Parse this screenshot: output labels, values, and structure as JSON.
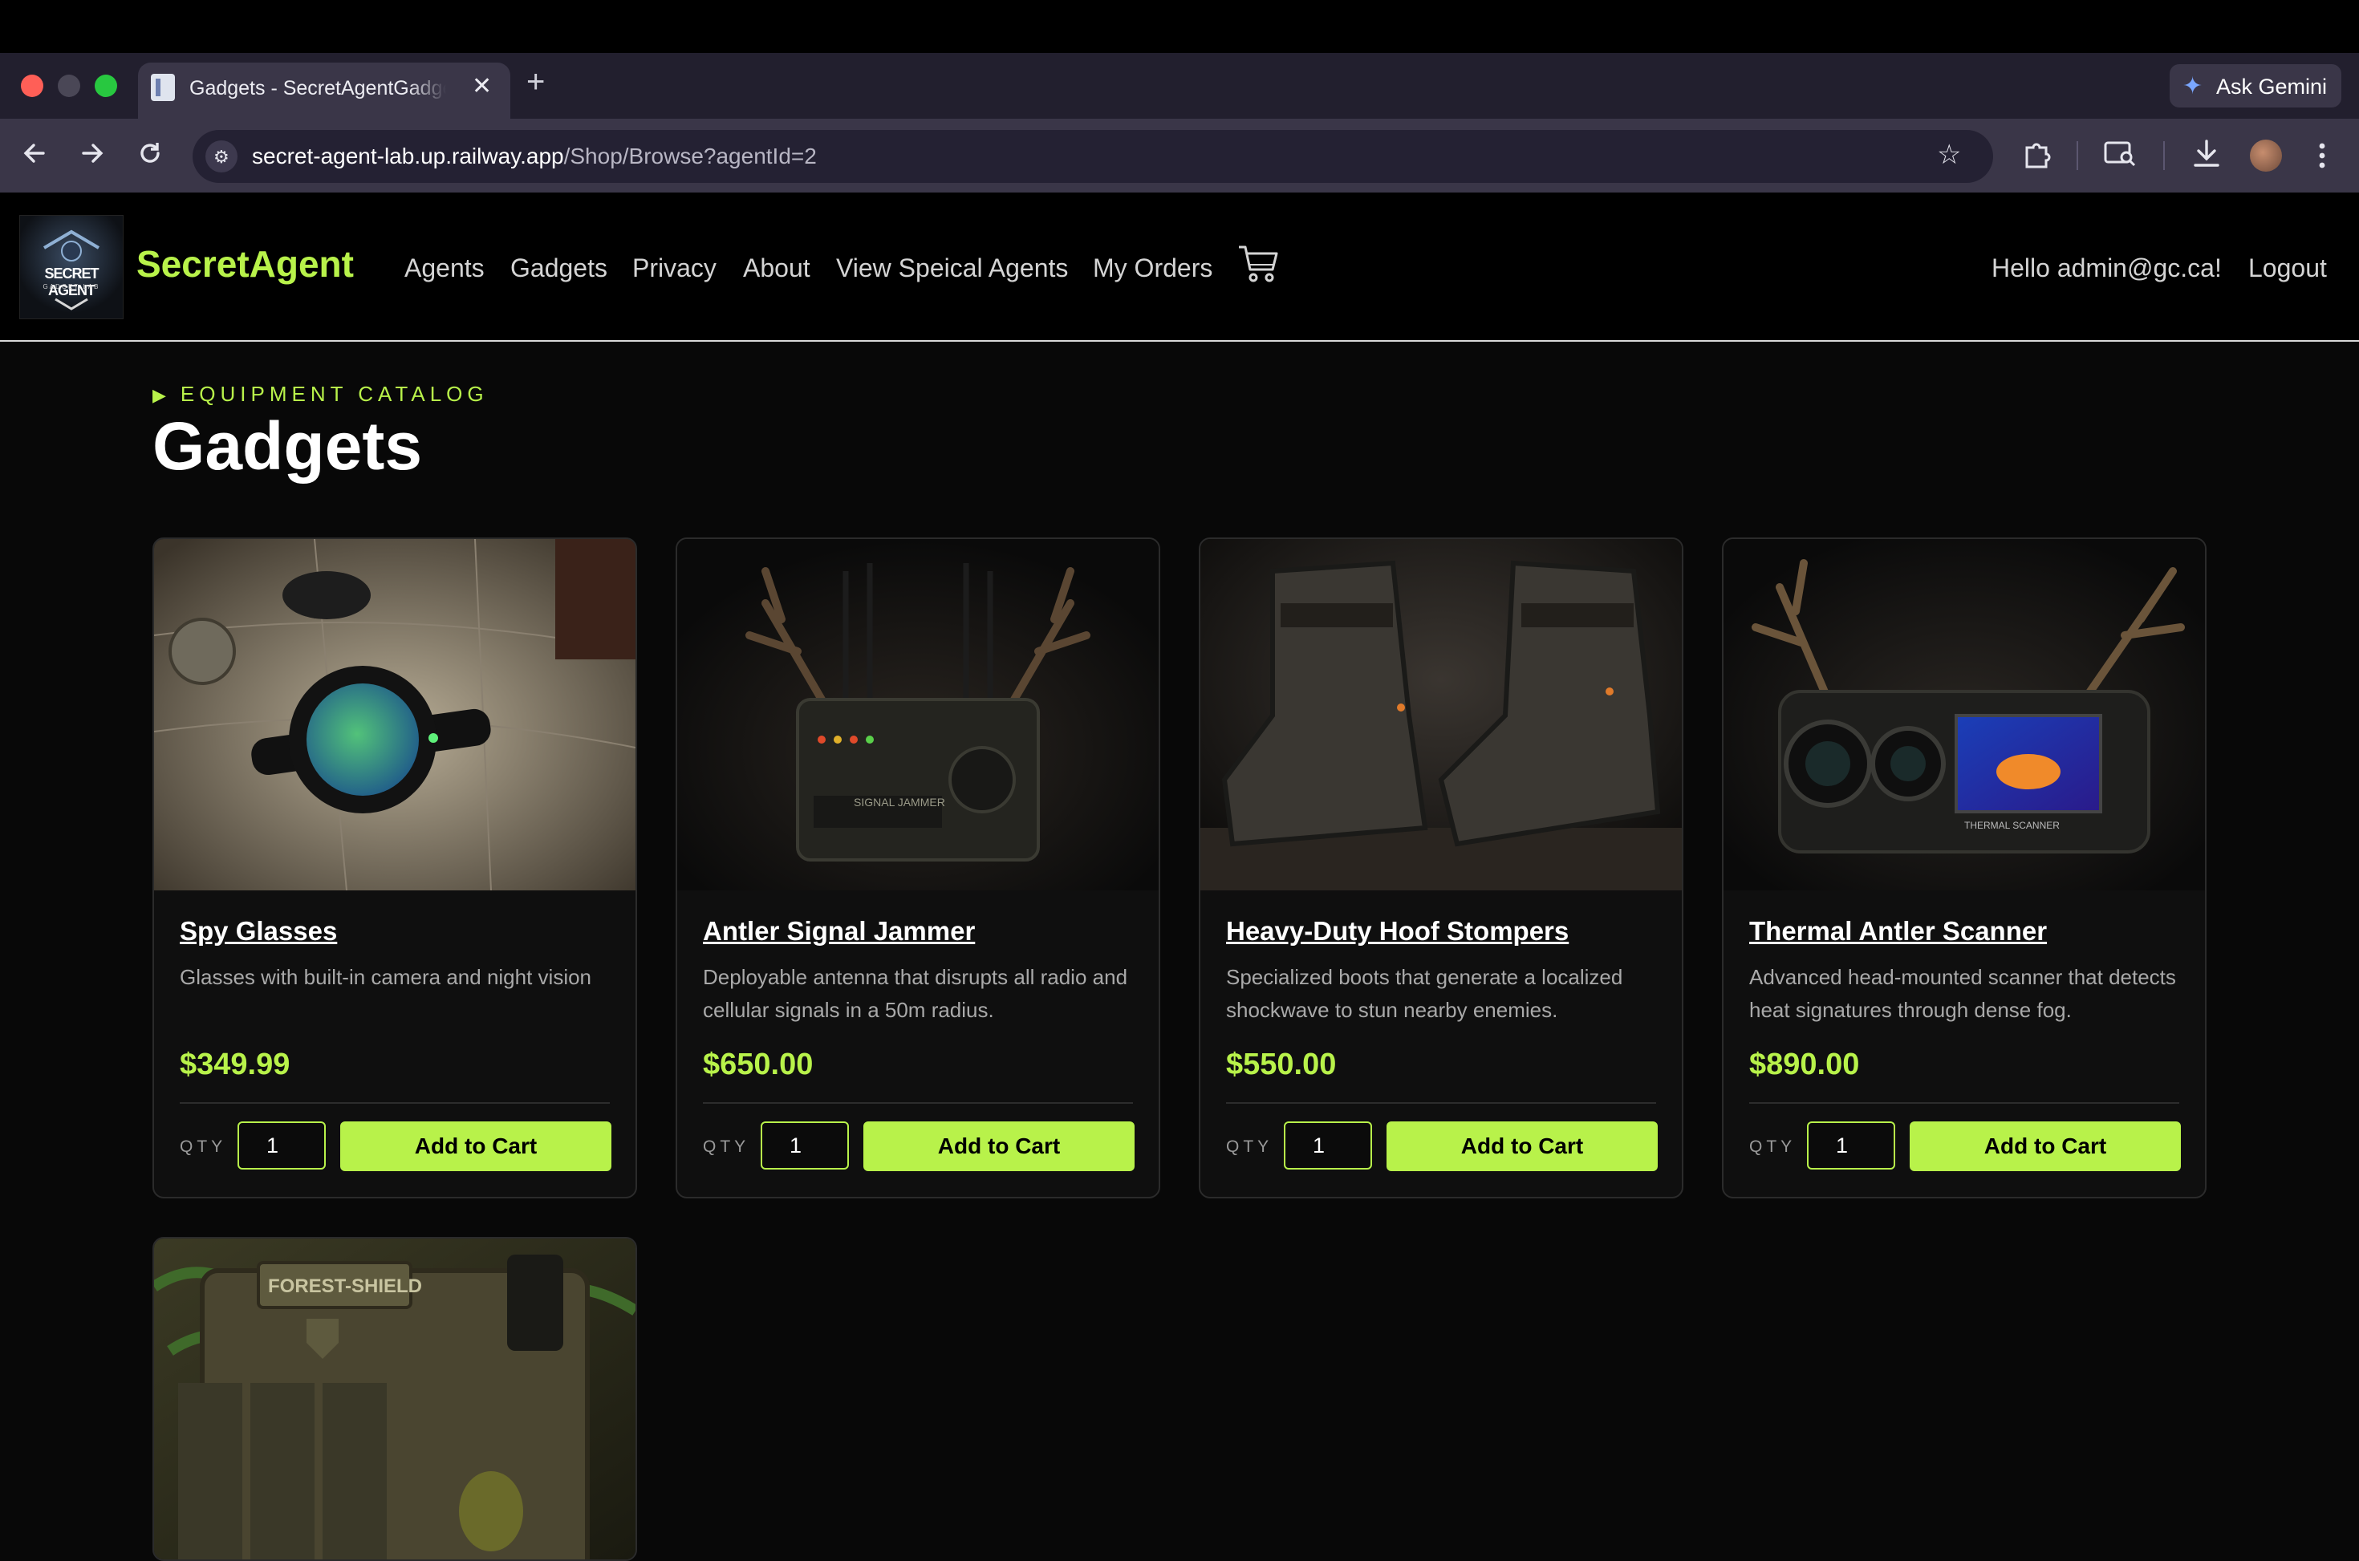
{
  "browser": {
    "tab_title": "Gadgets - SecretAgentGadgetLab",
    "new_tab_symbol": "+",
    "close_symbol": "✕",
    "ask_gemini_label": "Ask Gemini",
    "url_host": "secret-agent-lab.up.railway.app",
    "url_path": "/Shop/Browse?agentId=2"
  },
  "navbar": {
    "logo_text": "SECRET AGENT",
    "logo_subtext": "GADGET LAB",
    "brand": "SecretAgent",
    "links": [
      "Agents",
      "Gadgets",
      "Privacy",
      "About",
      "View Speical Agents",
      "My Orders"
    ],
    "greeting": "Hello admin@gc.ca!",
    "logout_label": "Logout"
  },
  "page": {
    "eyebrow": "EQUIPMENT CATALOG",
    "title": "Gadgets"
  },
  "products": [
    {
      "name": "Spy Glasses",
      "description": "Glasses with built-in camera and night vision",
      "price": "$349.99",
      "qty_label": "QTY",
      "qty_value": "1",
      "button_label": "Add to Cart"
    },
    {
      "name": "Antler Signal Jammer",
      "description": "Deployable antenna that disrupts all radio and cellular signals in a 50m radius.",
      "price": "$650.00",
      "qty_label": "QTY",
      "qty_value": "1",
      "button_label": "Add to Cart",
      "image_label": "SIGNAL JAMMER"
    },
    {
      "name": "Heavy-Duty Hoof Stompers",
      "description": "Specialized boots that generate a localized shockwave to stun nearby enemies.",
      "price": "$550.00",
      "qty_label": "QTY",
      "qty_value": "1",
      "button_label": "Add to Cart"
    },
    {
      "name": "Thermal Antler Scanner",
      "description": "Advanced head-mounted scanner that detects heat signatures through dense fog.",
      "price": "$890.00",
      "qty_label": "QTY",
      "qty_value": "1",
      "button_label": "Add to Cart",
      "image_label": "THERMAL SCANNER"
    },
    {
      "image_label": "FOREST-SHIELD"
    }
  ],
  "colors": {
    "accent": "#b8f24a",
    "background": "#080808",
    "card": "#0f0f0f"
  }
}
